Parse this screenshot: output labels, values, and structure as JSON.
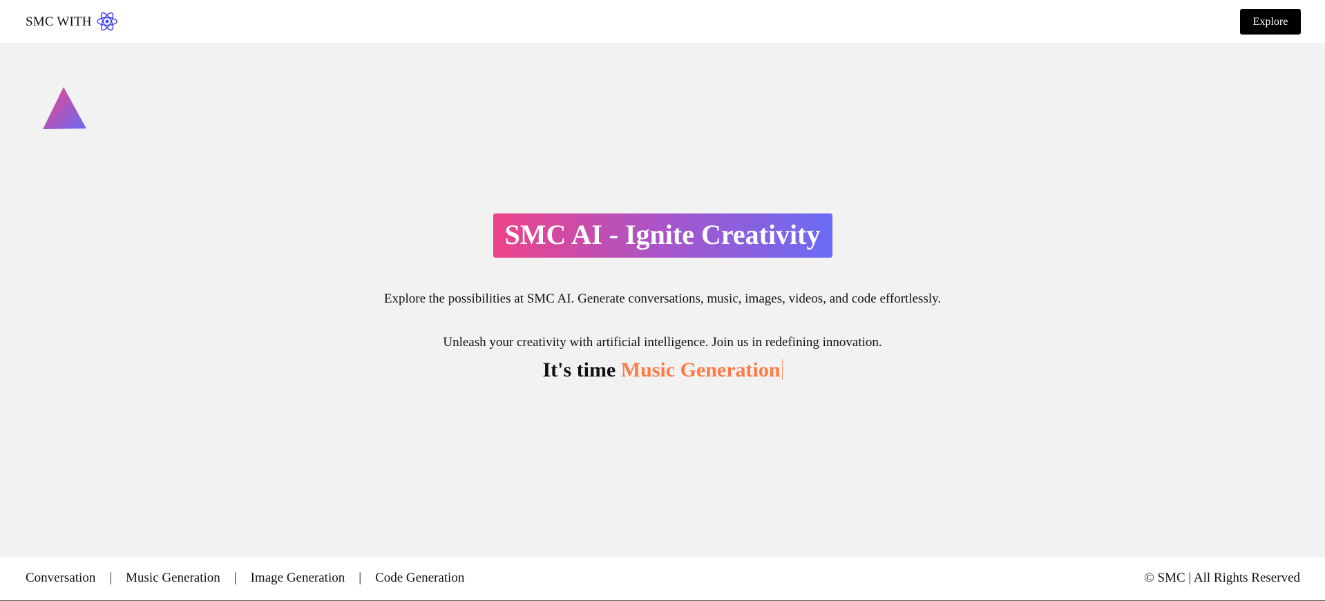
{
  "header": {
    "brand_text": "SMC WITH",
    "brand_icon": "atom-icon",
    "explore_label": "Explore"
  },
  "decoration": {
    "shape_icon": "triangle-icon",
    "gradient_colors": [
      "#ee4287",
      "#6a6cf5"
    ]
  },
  "hero": {
    "title": "SMC AI - Ignite Creativity",
    "description": "Explore the possibilities at SMC AI. Generate conversations, music, images, videos, and code effortlessly.",
    "description2": "Unleash your creativity with artificial intelligence. Join us in redefining innovation.",
    "typing_prefix": "It's time ",
    "typing_word": "Music Generation",
    "accent_color": "#ff7a45"
  },
  "footer": {
    "links": [
      {
        "label": "Conversation"
      },
      {
        "label": "Music Generation"
      },
      {
        "label": "Image Generation"
      },
      {
        "label": "Code Generation"
      }
    ],
    "separator": "|",
    "copyright": "© SMC | All Rights Reserved"
  }
}
